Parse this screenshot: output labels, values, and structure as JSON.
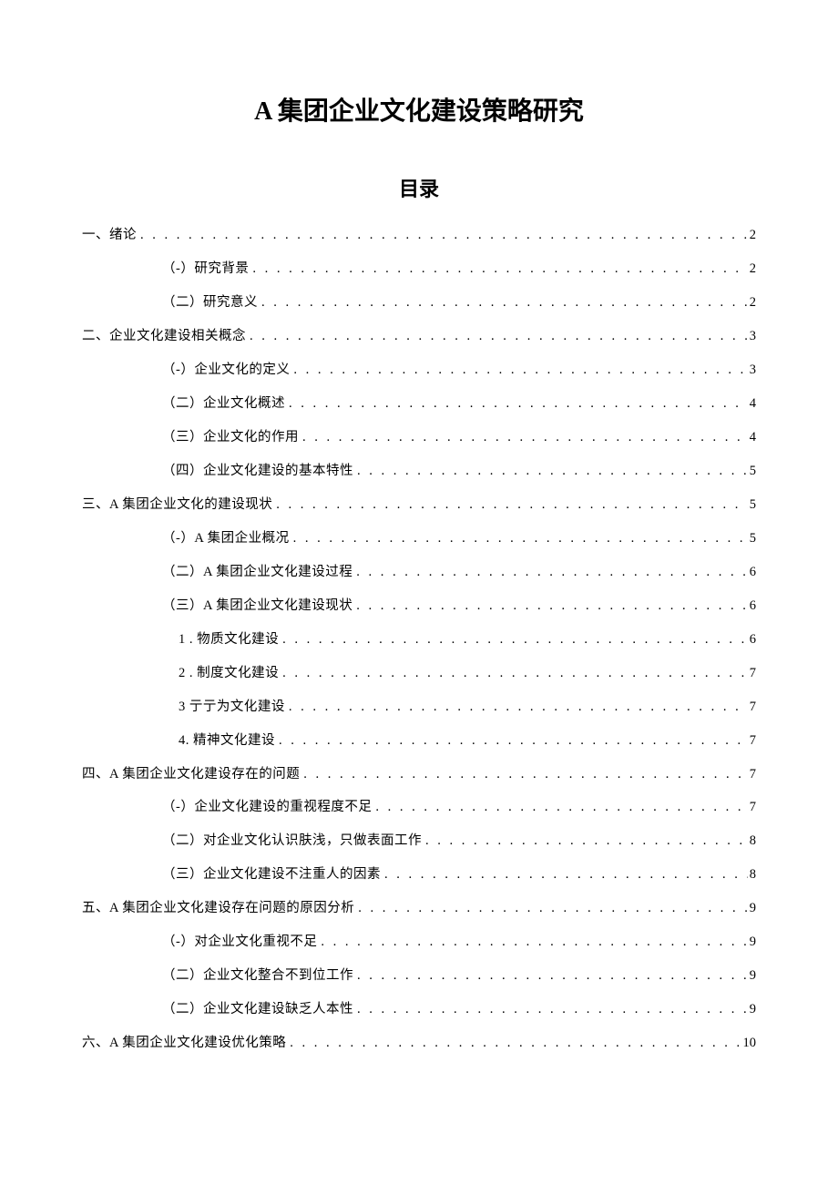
{
  "title": "A 集团企业文化建设策略研究",
  "toc_heading": "目录",
  "toc": [
    {
      "level": 1,
      "label": "一、绪论",
      "page": "2"
    },
    {
      "level": 2,
      "label": "（-）研究背景",
      "page": "2"
    },
    {
      "level": 2,
      "label": "（二）研究意义",
      "page": "2"
    },
    {
      "level": 1,
      "label": "二、企业文化建设相关概念",
      "page": "3"
    },
    {
      "level": 2,
      "label": "（-）企业文化的定义",
      "page": "3"
    },
    {
      "level": 2,
      "label": "（二）企业文化概述",
      "page": "4"
    },
    {
      "level": 2,
      "label": "（三）企业文化的作用",
      "page": "4"
    },
    {
      "level": 2,
      "label": "（四）企业文化建设的基本特性",
      "page": "5"
    },
    {
      "level": 1,
      "label": "三、A 集团企业文化的建设现状",
      "page": "5"
    },
    {
      "level": 2,
      "label": "（-）A 集团企业概况",
      "page": "5"
    },
    {
      "level": 2,
      "label": "（二）A 集团企业文化建设过程",
      "page": "6"
    },
    {
      "level": 2,
      "label": "（三）A 集团企业文化建设现状",
      "page": "6"
    },
    {
      "level": 3,
      "label": "1  . 物质文化建设",
      "page": "6"
    },
    {
      "level": 3,
      "label": "2  . 制度文化建设",
      "page": "7"
    },
    {
      "level": 3,
      "label": "3  亍亍为文化建设",
      "page": "7"
    },
    {
      "level": 3,
      "label": "4. 精神文化建设",
      "page": "7"
    },
    {
      "level": 1,
      "label": "四、A 集团企业文化建设存在的问题",
      "page": "7"
    },
    {
      "level": 2,
      "label": "（-）企业文化建设的重视程度不足",
      "page": "7"
    },
    {
      "level": 2,
      "label": "（二）对企业文化认识肤浅，只做表面工作",
      "page": "8"
    },
    {
      "level": 2,
      "label": "（三）企业文化建设不注重人的因素",
      "page": "8"
    },
    {
      "level": 1,
      "label": "五、A 集团企业文化建设存在问题的原因分析",
      "page": "9"
    },
    {
      "level": 2,
      "label": "（-）对企业文化重视不足",
      "page": "9"
    },
    {
      "level": 2,
      "label": "（二）企业文化整合不到位工作",
      "page": "9"
    },
    {
      "level": 2,
      "label": "（二）企业文化建设缺乏人本性",
      "page": "9"
    },
    {
      "level": 1,
      "label": "六、A 集团企业文化建设优化策略",
      "page": "10"
    }
  ]
}
